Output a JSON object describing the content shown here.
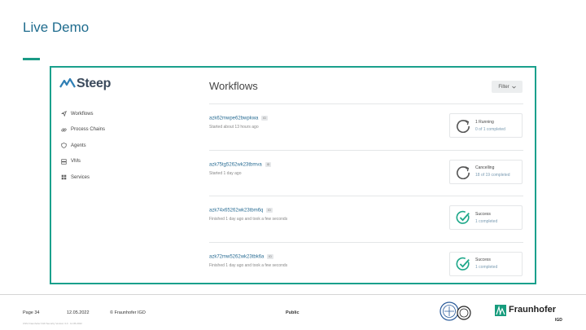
{
  "slide": {
    "title": "Live Demo"
  },
  "app": {
    "logo_text": "Steep",
    "nav": [
      {
        "label": "Workflows",
        "icon": "send-icon"
      },
      {
        "label": "Process Chains",
        "icon": "link-icon"
      },
      {
        "label": "Agents",
        "icon": "shield-icon"
      },
      {
        "label": "VMs",
        "icon": "server-icon"
      },
      {
        "label": "Services",
        "icon": "grid-icon"
      }
    ],
    "page_title": "Workflows",
    "filter_label": "Filter",
    "workflows": [
      {
        "id": "azk62mwpe62bwpkwa",
        "badge": "ID",
        "subtitle": "Started about 13 hours ago",
        "status": "1 Running",
        "detail": "0 of 1 completed",
        "icon": "running-icon"
      },
      {
        "id": "azk75tg5262wk23tbmva",
        "badge": "ID",
        "subtitle": "Started 1 day ago",
        "status": "Cancelling",
        "detail": "18 of 19 completed",
        "icon": "running-icon"
      },
      {
        "id": "azk74x65262wk23tbm6q",
        "badge": "ID",
        "subtitle": "Finished 1 day ago and took a few seconds",
        "status": "Success",
        "detail": "1 completed",
        "icon": "success-icon"
      },
      {
        "id": "azk72mw5262wk23tbk6a",
        "badge": "ID",
        "subtitle": "Finished 1 day ago and took a few seconds",
        "status": "Success",
        "detail": "1 completed",
        "icon": "success-icon"
      }
    ]
  },
  "footer": {
    "page": "Page 34",
    "date": "12.05.2022",
    "copyright": "© Fraunhofer IGD",
    "classification": "Public",
    "small_print": "CSS Fraunhofer IGD Security Version 3.0 · 11.05.2022",
    "brand": "Fraunhofer",
    "brand_sub": "IGD"
  },
  "colors": {
    "accent": "#1aa08c",
    "title": "#1f6c8e",
    "link": "#2a6d94",
    "success": "#1fa88a",
    "running": "#555555"
  }
}
